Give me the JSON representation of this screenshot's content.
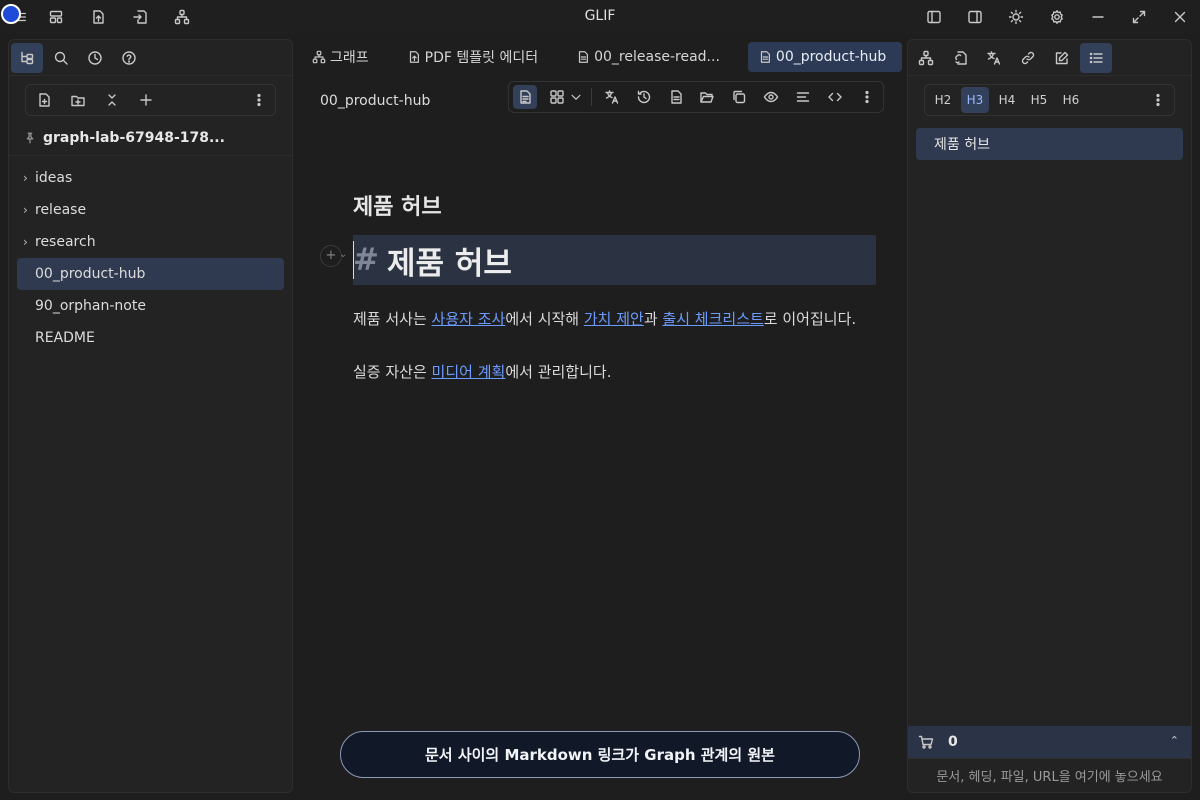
{
  "app": {
    "title": "GLIF"
  },
  "left_panel": {
    "vault_name": "graph-lab-67948-178...",
    "tree": [
      {
        "label": "ideas",
        "type": "folder"
      },
      {
        "label": "release",
        "type": "folder"
      },
      {
        "label": "research",
        "type": "folder"
      },
      {
        "label": "00_product-hub",
        "type": "file",
        "active": true
      },
      {
        "label": "90_orphan-note",
        "type": "file"
      },
      {
        "label": "README",
        "type": "file"
      }
    ]
  },
  "tabs": [
    {
      "label": "그래프",
      "icon": "graph-icon"
    },
    {
      "label": "PDF 템플릿 에디터",
      "icon": "pdf-file-icon"
    },
    {
      "label": "00_release-read...",
      "icon": "file-icon"
    },
    {
      "label": "00_product-hub",
      "icon": "file-icon",
      "active": true
    }
  ],
  "document": {
    "title": "00_product-hub",
    "heading_preview": "제품 허브",
    "heading_hash": "#",
    "heading_text": "제품 허브",
    "gutter_plus": "+",
    "para1": {
      "t1": "제품 서사는 ",
      "link1": "사용자 조사",
      "t2": "에서 시작해 ",
      "link2": "가치 제안",
      "t3": "과 ",
      "link3": "출시 체크리스트",
      "t4": "로 이어집니다."
    },
    "para2": {
      "t1": "실증 자산은 ",
      "link1": "미디어 계획",
      "t2": "에서 관리합니다."
    }
  },
  "banner": {
    "text": "문서 사이의 Markdown 링크가 Graph 관계의 원본"
  },
  "right_panel": {
    "heading_levels": [
      "H2",
      "H3",
      "H4",
      "H5",
      "H6"
    ],
    "active_level": "H3",
    "outline": [
      "제품 허브"
    ],
    "cart_count": "0",
    "drop_hint": "문서, 헤딩, 파일, URL을 여기에 놓으세요"
  },
  "colors": {
    "accent": "#33405a",
    "link": "#6c9bff",
    "banner_bg": "#111827"
  }
}
